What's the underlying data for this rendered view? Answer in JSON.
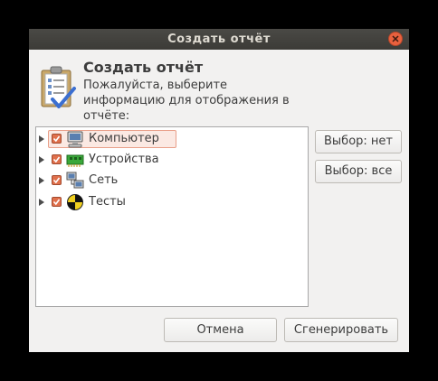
{
  "window": {
    "title": "Создать отчёт"
  },
  "header": {
    "title": "Создать отчёт",
    "description": "Пожалуйста, выберите информацию для отображения в отчёте:"
  },
  "tree": {
    "items": [
      {
        "label": "Компьютер",
        "checked": true,
        "selected": true,
        "icon": "computer-icon"
      },
      {
        "label": "Устройства",
        "checked": true,
        "selected": false,
        "icon": "devices-icon"
      },
      {
        "label": "Сеть",
        "checked": true,
        "selected": false,
        "icon": "network-icon"
      },
      {
        "label": "Тесты",
        "checked": true,
        "selected": false,
        "icon": "benchmarks-icon"
      }
    ]
  },
  "buttons": {
    "select_none": "Выбор: нет",
    "select_all": "Выбор: все",
    "cancel": "Отмена",
    "generate": "Сгенерировать"
  },
  "colors": {
    "titlebar": "#3c3b37",
    "close": "#e9613e",
    "checkbox": "#e0704c",
    "selection": "#fbe9e3"
  }
}
